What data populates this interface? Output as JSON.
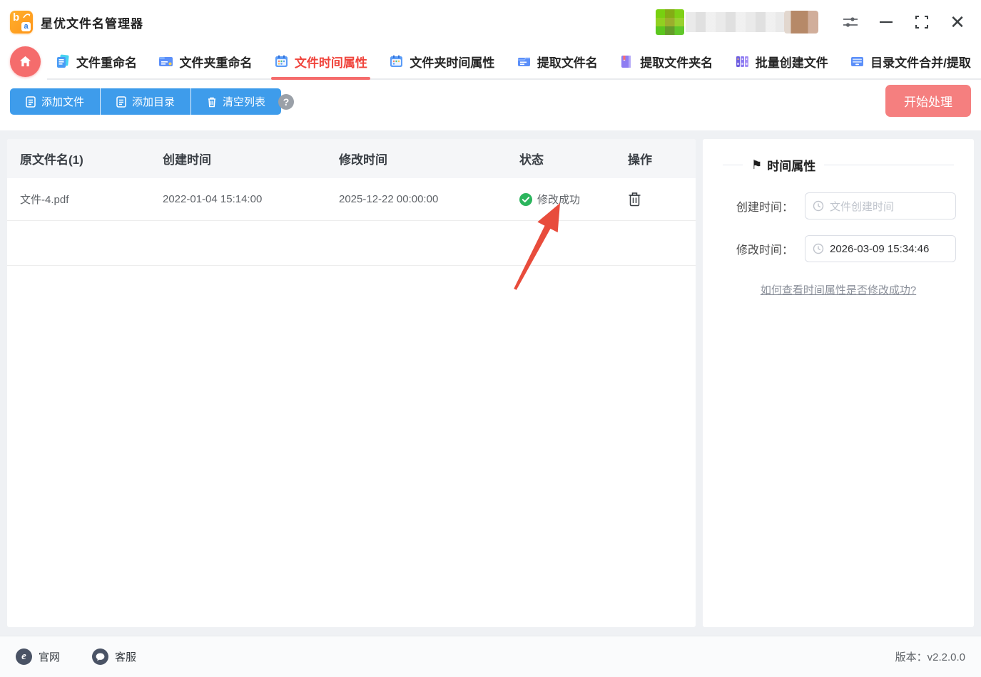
{
  "window": {
    "title": "星优文件名管理器",
    "controls": {
      "close_glyph": "✕"
    }
  },
  "tabs": [
    {
      "label": "文件重命名",
      "active": false
    },
    {
      "label": "文件夹重命名",
      "active": false
    },
    {
      "label": "文件时间属性",
      "active": true
    },
    {
      "label": "文件夹时间属性",
      "active": false
    },
    {
      "label": "提取文件名",
      "active": false
    },
    {
      "label": "提取文件夹名",
      "active": false
    },
    {
      "label": "批量创建文件",
      "active": false
    },
    {
      "label": "目录文件合并/提取",
      "active": false
    }
  ],
  "toolbar": {
    "add_file_label": "添加文件",
    "add_dir_label": "添加目录",
    "clear_list_label": "清空列表",
    "help_glyph": "?",
    "start_label": "开始处理"
  },
  "table": {
    "headers": [
      "原文件名(1)",
      "创建时间",
      "修改时间",
      "状态",
      "操作"
    ],
    "rows": [
      {
        "name": "文件-4.pdf",
        "created": "2022-01-04 15:14:00",
        "modified": "2025-12-22 00:00:00",
        "status": "修改成功"
      }
    ]
  },
  "panel": {
    "flag_glyph": "⚑",
    "title": "时间属性",
    "created_label": "创建时间：",
    "created_placeholder": "文件创建时间",
    "modified_label": "修改时间：",
    "modified_value": "2026-03-09 15:34:46",
    "help_link": "如何查看时间属性是否修改成功?"
  },
  "footer": {
    "website_label": "官网",
    "support_label": "客服",
    "version": "版本：v2.2.0.0"
  },
  "colors": {
    "accent_blue": "#3e9ceb",
    "accent_red": "#f56c6c",
    "active_tab_red": "#f0443c",
    "success_green": "#2bb55d",
    "arrow_red": "#e84c3c"
  }
}
